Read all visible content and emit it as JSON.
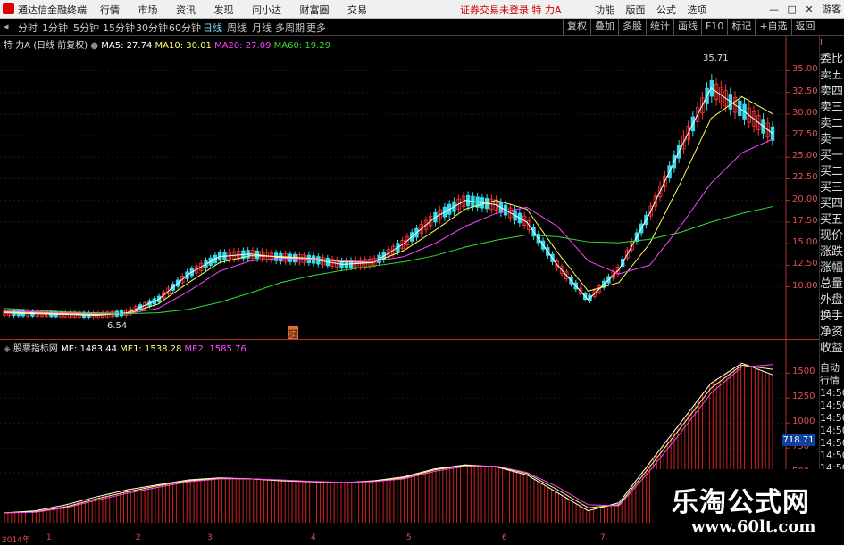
{
  "app": {
    "name": "通达信金融终端",
    "menu": [
      "行情",
      "市场",
      "资讯",
      "发现",
      "问小达",
      "财富圈",
      "交易"
    ],
    "title": "证券交易未登录  特 力A",
    "right_menu": [
      "功能",
      "版面",
      "公式",
      "选项"
    ],
    "window_buttons": [
      "—",
      "□",
      "✕"
    ],
    "user": "游客"
  },
  "tabs": [
    "分时",
    "1分钟",
    "5分钟",
    "15分钟",
    "30分钟",
    "60分钟",
    "日线",
    "周线",
    "月线",
    "多周期",
    "更多"
  ],
  "active_tab": "日线",
  "toolbar": [
    "复权",
    "叠加",
    "多股",
    "统计",
    "画线",
    "F10",
    "标记",
    "+自选",
    "返回"
  ],
  "main_chart": {
    "legend_prefix": "特 力A (日线 前复权)",
    "ma_labels": [
      {
        "text": "MA5: 27.74",
        "color": "#ffffff"
      },
      {
        "text": "MA10: 30.01",
        "color": "#ffff66"
      },
      {
        "text": "MA20: 27.09",
        "color": "#ff44ff"
      },
      {
        "text": "MA60: 19.29",
        "color": "#33dd33"
      }
    ],
    "y_ticks": [
      "35.00",
      "32.50",
      "30.00",
      "27.50",
      "25.00",
      "22.50",
      "20.00",
      "17.50",
      "15.00",
      "12.50",
      "10.00"
    ],
    "annotations": {
      "high": "35.71",
      "low": "6.54",
      "marker": "冠"
    }
  },
  "sub_chart": {
    "legend_prefix": "股票指标网",
    "labels": [
      {
        "text": "ME: 1483.44",
        "color": "#ffffff"
      },
      {
        "text": "ME1: 1538.28",
        "color": "#ffff66"
      },
      {
        "text": "ME2: 1585.76",
        "color": "#ff44ff"
      }
    ],
    "y_ticks": [
      "1500",
      "1250",
      "1000",
      "750",
      "500"
    ],
    "current_value": "718.71"
  },
  "date_axis": [
    "2014年",
    "1",
    "2",
    "3",
    "4",
    "5",
    "6",
    "7"
  ],
  "side_panel": {
    "top_label": "L",
    "items": [
      "委比",
      "卖五",
      "卖四",
      "卖三",
      "卖二",
      "卖一",
      "买一",
      "买二",
      "买三",
      "买四",
      "买五",
      "现价",
      "涨跌",
      "涨幅",
      "总量",
      "外盘",
      "换手",
      "净资",
      "收益"
    ],
    "bottom_items": [
      "自动",
      "行情",
      "14:50",
      "14:50",
      "14:50",
      "14:50",
      "14:50",
      "14:50",
      "14:50",
      "14:50",
      "14:50",
      "14:50"
    ]
  },
  "watermark": {
    "line1": "乐淘公式网",
    "line2": "www.60lt.com"
  },
  "chart_data": {
    "type": "line",
    "series": [
      {
        "name": "MA5",
        "values": [
          7.0,
          6.9,
          6.8,
          6.7,
          7.0,
          8.5,
          11.5,
          13.5,
          13.8,
          13.4,
          13.2,
          12.6,
          12.8,
          15.0,
          18.0,
          20.0,
          19.5,
          17.5,
          12.5,
          8.5,
          12.0,
          18.5,
          26.0,
          33.0,
          30.5,
          27.74
        ]
      },
      {
        "name": "MA10",
        "values": [
          7.1,
          7.0,
          6.9,
          6.8,
          6.9,
          8.0,
          10.5,
          12.8,
          13.6,
          13.5,
          13.3,
          12.9,
          12.8,
          14.2,
          16.5,
          19.0,
          20.0,
          19.0,
          14.0,
          9.5,
          10.5,
          15.0,
          22.0,
          29.5,
          32.0,
          30.01
        ]
      },
      {
        "name": "MA20",
        "values": [
          7.2,
          7.1,
          7.0,
          6.9,
          6.9,
          7.5,
          9.5,
          11.8,
          13.0,
          13.3,
          13.2,
          13.0,
          12.9,
          13.5,
          15.0,
          17.0,
          18.5,
          19.2,
          17.0,
          13.0,
          11.5,
          12.5,
          17.0,
          22.0,
          25.5,
          27.09
        ]
      },
      {
        "name": "MA60",
        "values": [
          7.5,
          7.3,
          7.1,
          7.0,
          6.9,
          7.0,
          7.4,
          8.2,
          9.3,
          10.5,
          11.3,
          11.9,
          12.4,
          12.9,
          13.6,
          14.6,
          15.4,
          16.0,
          15.8,
          15.2,
          15.1,
          15.5,
          16.3,
          17.5,
          18.5,
          19.29
        ]
      }
    ],
    "ylim": [
      5,
      37
    ],
    "sub_series": [
      {
        "name": "ME",
        "values": [
          100,
          120,
          180,
          260,
          330,
          380,
          430,
          450,
          440,
          420,
          410,
          400,
          420,
          460,
          540,
          580,
          560,
          480,
          300,
          120,
          200,
          600,
          1000,
          1400,
          1600,
          1483.44
        ]
      },
      {
        "name": "ME1",
        "values": [
          100,
          110,
          160,
          240,
          310,
          370,
          420,
          445,
          440,
          425,
          412,
          402,
          415,
          450,
          530,
          575,
          565,
          495,
          330,
          150,
          180,
          560,
          950,
          1350,
          1580,
          1538.28
        ]
      },
      {
        "name": "ME2",
        "values": [
          100,
          105,
          150,
          225,
          295,
          355,
          410,
          440,
          440,
          430,
          415,
          405,
          412,
          440,
          515,
          565,
          568,
          505,
          360,
          180,
          170,
          520,
          900,
          1300,
          1560,
          1585.76
        ]
      }
    ],
    "sub_ylim": [
      0,
      1700
    ]
  }
}
